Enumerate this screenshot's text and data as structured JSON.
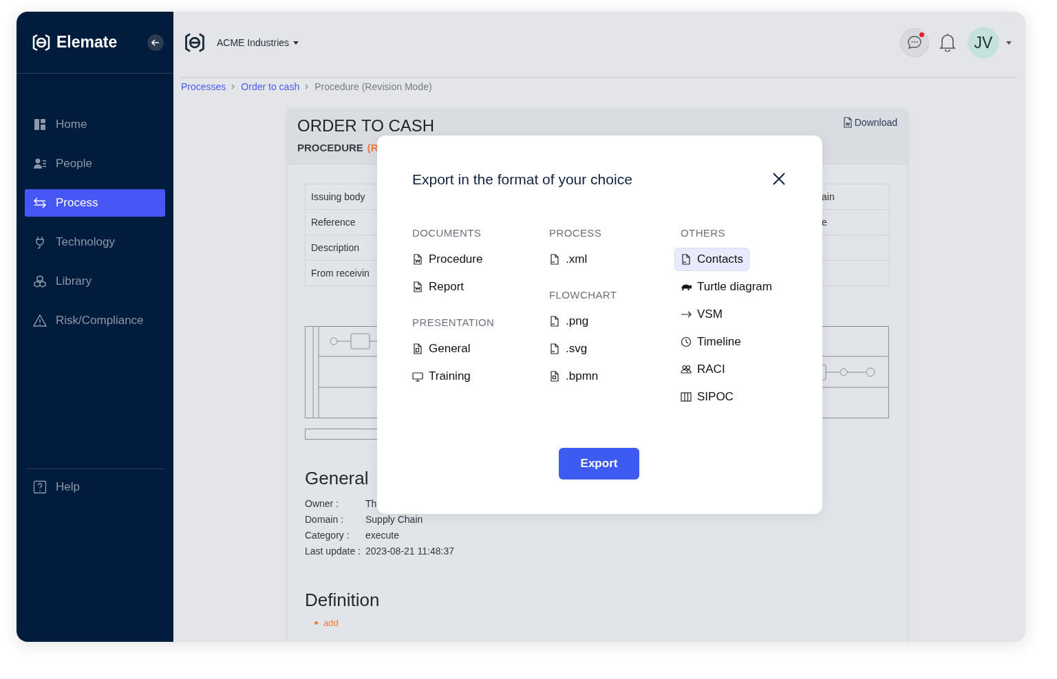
{
  "sidebar": {
    "brand": "Elemate",
    "items": [
      {
        "label": "Home",
        "selected": false
      },
      {
        "label": "People",
        "selected": false
      },
      {
        "label": "Process",
        "selected": true
      },
      {
        "label": "Technology",
        "selected": false
      },
      {
        "label": "Library",
        "selected": false
      },
      {
        "label": "Risk/Compliance",
        "selected": false
      }
    ],
    "help": "Help"
  },
  "header": {
    "organization": "ACME Industries",
    "chat_unread": true,
    "avatar_initials": "JV"
  },
  "breadcrumb": [
    {
      "label": "Processes",
      "kind": "link"
    },
    {
      "label": "Order to cash",
      "kind": "link"
    },
    {
      "label": "Procedure (Revision Mode)",
      "kind": "current"
    }
  ],
  "document": {
    "title": "ORDER TO CASH",
    "type": "PROCEDURE",
    "mode": "(R",
    "download": "Download",
    "properties": [
      {
        "label": "Issuing body",
        "value": "ain"
      },
      {
        "label": "Reference",
        "value": "e"
      },
      {
        "label": "Description"
      },
      {
        "label": "From receivin"
      }
    ],
    "general": {
      "title": "General",
      "fields": [
        {
          "label": "Owner :",
          "value": "Th"
        },
        {
          "label": "Domain :",
          "value": "Supply Chain"
        },
        {
          "label": "Category :",
          "value": "execute"
        },
        {
          "label": "Last update :",
          "value": "2023-08-21 11:48:37"
        }
      ]
    },
    "definition": {
      "title": "Definition",
      "items": [
        "add"
      ]
    }
  },
  "export_dialog": {
    "title": "Export in the format of your choice",
    "columns": [
      {
        "groups": [
          {
            "heading": "DOCUMENTS",
            "items": [
              {
                "label": "Procedure",
                "selected": false
              },
              {
                "label": "Report",
                "selected": false
              }
            ]
          },
          {
            "heading": "PRESENTATION",
            "items": [
              {
                "label": "General",
                "selected": false
              },
              {
                "label": "Training",
                "selected": false
              }
            ]
          }
        ]
      },
      {
        "groups": [
          {
            "heading": "PROCESS",
            "items": [
              {
                "label": ".xml",
                "selected": false
              }
            ]
          },
          {
            "heading": "FLOWCHART",
            "items": [
              {
                "label": ".png",
                "selected": false
              },
              {
                "label": ".svg",
                "selected": false
              },
              {
                "label": ".bpmn",
                "selected": false
              }
            ]
          }
        ]
      },
      {
        "groups": [
          {
            "heading": "OTHERS",
            "items": [
              {
                "label": "Contacts",
                "selected": true
              },
              {
                "label": "Turtle diagram",
                "selected": false
              },
              {
                "label": "VSM",
                "selected": false
              },
              {
                "label": "Timeline",
                "selected": false
              },
              {
                "label": "RACI",
                "selected": false
              },
              {
                "label": "SIPOC",
                "selected": false
              }
            ]
          }
        ]
      }
    ],
    "button": "Export"
  }
}
